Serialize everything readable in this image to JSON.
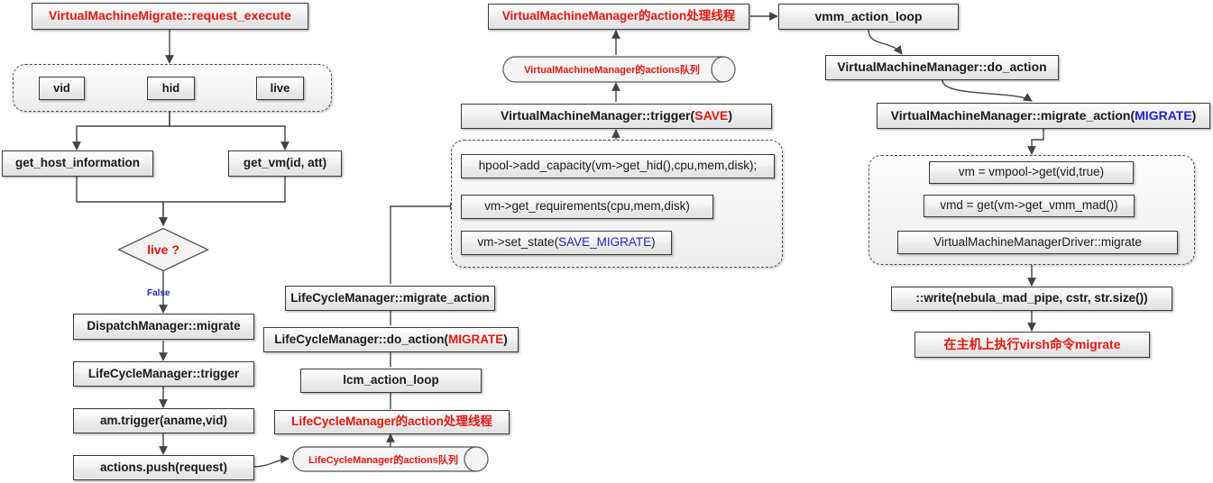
{
  "diagram": {
    "title": "OpenNebula VirtualMachineMigrate request flow",
    "colors": {
      "accent_red": "#e8160f",
      "accent_blue": "#2222cc",
      "node_border": "#3a3a3a",
      "node_fill": "#f0f0f0",
      "group_border": "#4a4a4a",
      "background": "#ffffff"
    }
  },
  "left_column": {
    "entry": "VirtualMachineMigrate::request_execute",
    "params_group": {
      "name": "request-parameters-group",
      "items": [
        "vid",
        "hid",
        "live"
      ]
    },
    "get_host_information": "get_host_information",
    "get_vm": "get_vm(id, att)",
    "decision": {
      "label": "live",
      "question_mark": "?",
      "full": "live ?",
      "branch_label": "False"
    },
    "dispatch_migrate": "DispatchManager::migrate",
    "lcm_trigger": "LifeCycleManager::trigger",
    "am_trigger": "am.trigger(aname,vid)",
    "actions_push": "actions.push(request)"
  },
  "middle_column": {
    "lcm_queue": {
      "prefix": "LifeCycleManager",
      "mid": "的actions",
      "suffix": "队列",
      "full": "LifeCycleManager的actions队列"
    },
    "lcm_thread": {
      "full": "LifeCycleManager的action处理线程"
    },
    "lcm_action_loop": "lcm_action_loop",
    "lcm_do_action": {
      "prefix": "LifeCycleManager::do_action(",
      "arg": "MIGRATE",
      "suffix": ")",
      "arg_color": "#e8160f",
      "full": "LifeCycleManager::do_action(MIGRATE)"
    },
    "lcm_migrate_action": "LifeCycleManager::migrate_action",
    "vmm_steps_group": {
      "name": "vmm-trigger-steps-group",
      "items": [
        "hpool->add_capacity(vm->get_hid(),cpu,mem,disk);",
        "vm->get_requirements(cpu,mem,disk)",
        "vm->set_state(SAVE_MIGRATE)"
      ],
      "item3_prefix": "vm->set_state(",
      "item3_arg": "SAVE_MIGRATE",
      "item3_suffix": ")",
      "item3_arg_color": "#2222cc"
    },
    "vmm_trigger": {
      "prefix": "VirtualMachineManager::trigger(",
      "arg": "SAVE",
      "suffix": ")",
      "arg_color": "#e8160f",
      "full": "VirtualMachineManager::trigger(SAVE)"
    },
    "vmm_queue": {
      "full": "VirtualMachineManager的actions队列"
    },
    "vmm_thread": {
      "full": "VirtualMachineManager的action处理线程"
    }
  },
  "right_column": {
    "vmm_action_loop": "vmm_action_loop",
    "vmm_do_action": "VirtualMachineManager::do_action",
    "vmm_migrate_action": {
      "prefix": "VirtualMachineManager::migrate_action(",
      "arg": "MIGRATE",
      "suffix": ")",
      "arg_color": "#2222cc",
      "full": "VirtualMachineManager::migrate_action(MIGRATE)"
    },
    "driver_group": {
      "name": "vmm-driver-steps-group",
      "items": [
        "vm = vmpool->get(vid,true)",
        "vmd = get(vm->get_vmm_mad())",
        "VirtualMachineManagerDriver::migrate"
      ]
    },
    "write_pipe": "::write(nebula_mad_pipe, cstr, str.size())",
    "host_exec": {
      "full": "在主机上执行virsh命令migrate"
    }
  }
}
